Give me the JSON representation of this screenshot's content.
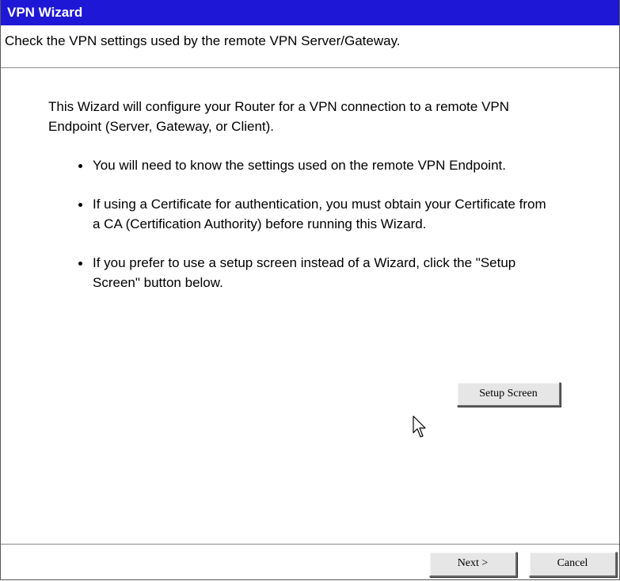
{
  "window": {
    "title": "VPN Wizard",
    "subtitle": "Check the VPN settings used by the remote VPN Server/Gateway."
  },
  "main": {
    "intro": "This Wizard will configure your Router for a VPN connection to a remote VPN Endpoint (Server, Gateway, or Client).",
    "bullets": [
      "You will need to know the settings used on the remote VPN Endpoint.",
      "If using a Certificate for authentication, you must obtain your Certificate from a CA (Certification Authority) before running this Wizard.",
      "If you prefer to use a setup screen instead of a Wizard, click the \"Setup Screen\" button below."
    ],
    "setup_button_label": "Setup Screen"
  },
  "footer": {
    "next_label": "Next >",
    "cancel_label": "Cancel"
  },
  "colors": {
    "titlebar_bg": "#1f17d6",
    "titlebar_text": "#ffffff",
    "button_face": "#e6e6e6"
  },
  "icons": {
    "cursor": "mouse-pointer-arrow-icon"
  }
}
